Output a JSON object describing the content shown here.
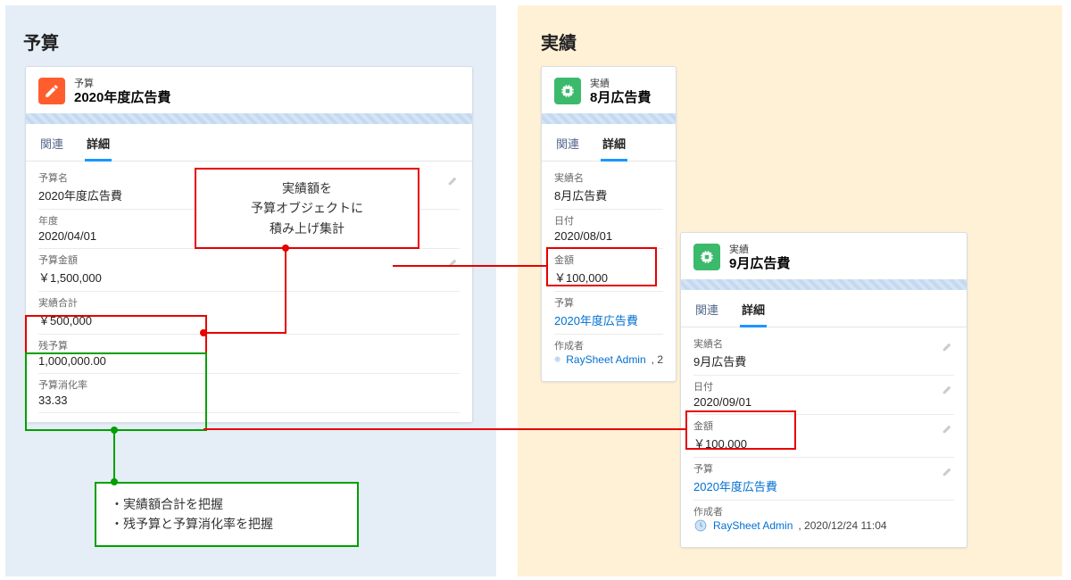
{
  "left": {
    "section_title": "予算",
    "card": {
      "object_label": "予算",
      "title": "2020年度広告費",
      "tabs": {
        "related": "関連",
        "detail": "詳細"
      },
      "fields": {
        "name": {
          "label": "予算名",
          "value": "2020年度広告費"
        },
        "year": {
          "label": "年度",
          "value": "2020/04/01"
        },
        "amount": {
          "label": "予算金額",
          "value": "￥1,500,000"
        },
        "actual_total": {
          "label": "実績合計",
          "value": "￥500,000"
        },
        "remaining": {
          "label": "残予算",
          "value": "1,000,000.00"
        },
        "rate": {
          "label": "予算消化率",
          "value": "33.33"
        }
      }
    }
  },
  "right": {
    "section_title": "実績",
    "card1": {
      "object_label": "実績",
      "title": "8月広告費",
      "tabs": {
        "related": "関連",
        "detail": "詳細"
      },
      "fields": {
        "name": {
          "label": "実績名",
          "value": "8月広告費"
        },
        "date": {
          "label": "日付",
          "value": "2020/08/01"
        },
        "amount": {
          "label": "金額",
          "value": "￥100,000"
        },
        "budget": {
          "label": "予算",
          "value": "2020年度広告費"
        },
        "author_label": "作成者",
        "author_name": "RaySheet Admin",
        "author_ts_partial": ", 2"
      }
    },
    "card2": {
      "object_label": "実績",
      "title": "9月広告費",
      "tabs": {
        "related": "関連",
        "detail": "詳細"
      },
      "fields": {
        "name": {
          "label": "実績名",
          "value": "9月広告費"
        },
        "date": {
          "label": "日付",
          "value": "2020/09/01"
        },
        "amount": {
          "label": "金額",
          "value": "￥100,000"
        },
        "budget": {
          "label": "予算",
          "value": "2020年度広告費"
        },
        "author_label": "作成者",
        "author_name": "RaySheet Admin",
        "author_ts": ", 2020/12/24 11:04"
      }
    }
  },
  "callouts": {
    "red": {
      "line1": "実績額を",
      "line2": "予算オブジェクトに",
      "line3": "積み上げ集計"
    },
    "green": {
      "line1": "・実績額合計を把握",
      "line2": "・残予算と予算消化率を把握"
    }
  }
}
